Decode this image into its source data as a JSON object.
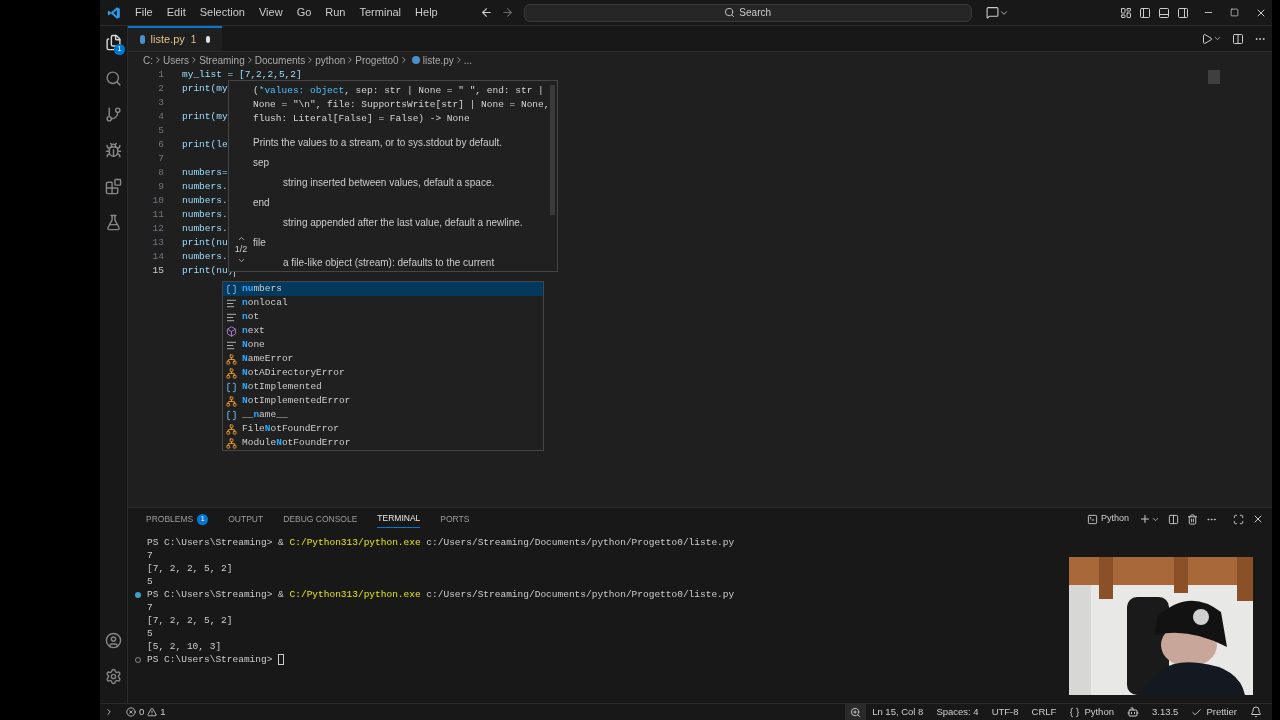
{
  "menu": [
    "File",
    "Edit",
    "Selection",
    "View",
    "Go",
    "Run",
    "Terminal",
    "Help"
  ],
  "search": {
    "placeholder": "Search"
  },
  "activity": {
    "explorer_badge": "1"
  },
  "tabs": [
    {
      "label": "liste.py",
      "problems": "1",
      "modified": true,
      "selected": true
    }
  ],
  "breadcrumbs": [
    "C:",
    "Users",
    "Streaming",
    "Documents",
    "python",
    "Progetto0",
    "liste.py",
    "..."
  ],
  "editor": {
    "lines": [
      {
        "number": "1",
        "text": "my_list = [7,2,2,5,2]",
        "active": false
      },
      {
        "number": "2",
        "text": "print(my",
        "active": false
      },
      {
        "number": "3",
        "active": false
      },
      {
        "number": "4",
        "text": "print(my",
        "active": false
      },
      {
        "number": "5",
        "active": false
      },
      {
        "number": "6",
        "text": "print(le",
        "active": false
      },
      {
        "number": "7",
        "active": false
      },
      {
        "number": "8",
        "text": "numbers=",
        "active": false
      },
      {
        "number": "9",
        "text": "numbers.",
        "active": false
      },
      {
        "number": "10",
        "text": "numbers.",
        "active": false
      },
      {
        "number": "11",
        "text": "numbers.",
        "active": false
      },
      {
        "number": "12",
        "text": "numbers.",
        "active": false
      },
      {
        "number": "13",
        "text": "print(nu",
        "active": false
      },
      {
        "number": "14",
        "text": "numbers.",
        "active": false
      },
      {
        "number": "15",
        "text": "print(nu)",
        "active": true
      }
    ]
  },
  "hover": {
    "counter": "1/2",
    "signature": [
      [
        {
          "text": "(",
          "active": false
        },
        {
          "text": "*values: object",
          "active": true
        },
        {
          "text": ", sep: str | None = \" \", end: str |",
          "active": false
        }
      ],
      [
        {
          "text": "None = \"\\n\", file: SupportsWrite[str] | None = None,",
          "active": false
        }
      ],
      [
        {
          "text": "flush: Literal[False] = False) -> None",
          "active": false
        }
      ]
    ],
    "description": "Prints the values to a stream, or to sys.stdout by default.",
    "params": [
      {
        "name": "sep",
        "doc": "string inserted between values, default a space."
      },
      {
        "name": "end",
        "doc": "string appended after the last value, default a newline."
      },
      {
        "name": "file",
        "doc": "a file-like object (stream): defaults to the current"
      }
    ]
  },
  "suggestions": [
    {
      "kind": "variable",
      "selected": true,
      "parts": [
        {
          "text": "nu",
          "match": true
        },
        {
          "text": "mbers",
          "match": false
        }
      ]
    },
    {
      "kind": "keyword",
      "selected": false,
      "parts": [
        {
          "text": "n",
          "match": true
        },
        {
          "text": "onlocal",
          "match": false
        }
      ]
    },
    {
      "kind": "keyword",
      "selected": false,
      "parts": [
        {
          "text": "n",
          "match": true
        },
        {
          "text": "ot",
          "match": false
        }
      ]
    },
    {
      "kind": "function",
      "selected": false,
      "parts": [
        {
          "text": "n",
          "match": true
        },
        {
          "text": "ext",
          "match": false
        }
      ]
    },
    {
      "kind": "keyword",
      "selected": false,
      "parts": [
        {
          "text": "N",
          "match": true
        },
        {
          "text": "one",
          "match": false
        }
      ]
    },
    {
      "kind": "class",
      "selected": false,
      "parts": [
        {
          "text": "N",
          "match": true
        },
        {
          "text": "ameError",
          "match": false
        }
      ]
    },
    {
      "kind": "class",
      "selected": false,
      "parts": [
        {
          "text": "N",
          "match": true
        },
        {
          "text": "otADirectoryError",
          "match": false
        }
      ]
    },
    {
      "kind": "variable",
      "selected": false,
      "parts": [
        {
          "text": "N",
          "match": true
        },
        {
          "text": "otImplemented",
          "match": false
        }
      ]
    },
    {
      "kind": "class",
      "selected": false,
      "parts": [
        {
          "text": "N",
          "match": true
        },
        {
          "text": "otImplementedError",
          "match": false
        }
      ]
    },
    {
      "kind": "variable",
      "selected": false,
      "parts": [
        {
          "text": "__",
          "match": false
        },
        {
          "text": "n",
          "match": true
        },
        {
          "text": "ame__",
          "match": false
        }
      ]
    },
    {
      "kind": "class",
      "selected": false,
      "parts": [
        {
          "text": "File",
          "match": false
        },
        {
          "text": "N",
          "match": true
        },
        {
          "text": "otFoundError",
          "match": false
        }
      ]
    },
    {
      "kind": "class",
      "selected": false,
      "parts": [
        {
          "text": "Module",
          "match": false
        },
        {
          "text": "N",
          "match": true
        },
        {
          "text": "otFoundError",
          "match": false
        }
      ]
    }
  ],
  "panel": {
    "tabs": [
      {
        "label": "PROBLEMS",
        "badge": "1",
        "selected": false
      },
      {
        "label": "OUTPUT",
        "selected": false
      },
      {
        "label": "DEBUG CONSOLE",
        "selected": false
      },
      {
        "label": "TERMINAL",
        "selected": true
      },
      {
        "label": "PORTS",
        "selected": false
      }
    ],
    "terminal_name": "Python",
    "lines": [
      {
        "kind": "plain",
        "parts": [
          {
            "text": "PS C:\\Users\\Streaming> & ",
            "kind": "plain"
          },
          {
            "text": "C:/Python313/python.exe",
            "kind": "exe"
          },
          {
            "text": " c:/Users/Streaming/Documents/python/Progetto0/liste.py",
            "kind": "plain"
          }
        ]
      },
      {
        "kind": "plain",
        "parts": [
          {
            "text": "7",
            "kind": "plain"
          }
        ]
      },
      {
        "kind": "plain",
        "parts": [
          {
            "text": "[7, 2, 2, 5, 2]",
            "kind": "plain"
          }
        ]
      },
      {
        "kind": "plain",
        "parts": [
          {
            "text": "5",
            "kind": "plain"
          }
        ]
      },
      {
        "kind": "success",
        "parts": [
          {
            "text": "PS C:\\Users\\Streaming> & ",
            "kind": "plain"
          },
          {
            "text": "C:/Python313/python.exe",
            "kind": "exe"
          },
          {
            "text": " c:/Users/Streaming/Documents/python/Progetto0/liste.py",
            "kind": "plain"
          }
        ]
      },
      {
        "kind": "plain",
        "parts": [
          {
            "text": "7",
            "kind": "plain"
          }
        ]
      },
      {
        "kind": "plain",
        "parts": [
          {
            "text": "[7, 2, 2, 5, 2]",
            "kind": "plain"
          }
        ]
      },
      {
        "kind": "plain",
        "parts": [
          {
            "text": "5",
            "kind": "plain"
          }
        ]
      },
      {
        "kind": "plain",
        "parts": [
          {
            "text": "[5, 2, 10, 3]",
            "kind": "plain"
          }
        ]
      },
      {
        "kind": "pending",
        "cursor": true,
        "parts": [
          {
            "text": "PS C:\\Users\\Streaming> ",
            "kind": "plain"
          }
        ]
      }
    ]
  },
  "webcam": {
    "kind": "picture"
  },
  "status": {
    "errors": "0",
    "warnings": "1",
    "items": [
      {
        "kind": "text",
        "text": "Ln 15, Col 8"
      },
      {
        "kind": "text",
        "text": "Spaces: 4"
      },
      {
        "kind": "text",
        "text": "UTF-8"
      },
      {
        "kind": "text",
        "text": "CRLF"
      },
      {
        "kind": "language",
        "text": "Python"
      },
      {
        "kind": "copilot"
      },
      {
        "kind": "text",
        "text": "3.13.5"
      },
      {
        "kind": "check",
        "text": "Prettier"
      },
      {
        "kind": "bell"
      }
    ]
  }
}
